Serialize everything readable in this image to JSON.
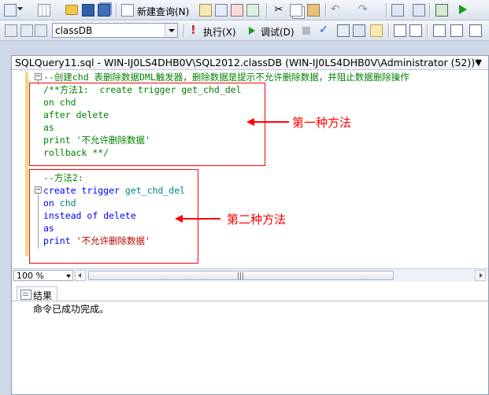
{
  "toolbar1": {
    "new_query_label": "新建查询(N)"
  },
  "toolbar2": {
    "database_value": "classDB",
    "execute_label": "执行(X)",
    "debug_label": "调试(D)"
  },
  "document": {
    "title": "SQLQuery11.sql - WIN-IJ0LS4DHB0V\\SQL2012.classDB (WIN-IJ0LS4DHB0V\\Administrator (52))*"
  },
  "editor": {
    "line1": "--创建chd 表删除数据DML触发器，删除数据是提示不允许删除数据，并阻止数据删除操作",
    "m1_comment_open": "/**方法1:  ",
    "m1_create": "create",
    "m1_trigger": "trigger",
    "m1_name": "get_chd_del",
    "m1_on": "on",
    "m1_table": "chd",
    "m1_after": "after",
    "m1_delete": "delete",
    "m1_as": "as",
    "m1_print": "print",
    "m1_msg": "'不允许删除数据'",
    "m1_rollback": "rollback",
    "m1_comment_close": "**/",
    "m2_comment": "--方法2:",
    "m2_create": "create",
    "m2_trigger": "trigger",
    "m2_name": "get_chd_del",
    "m2_on": "on",
    "m2_table": "chd",
    "m2_instead": "instead",
    "m2_of": "of",
    "m2_delete": "delete",
    "m2_as": "as",
    "m2_print": "print",
    "m2_msg": "'不允许删除数据'"
  },
  "annotations": {
    "method1": "第一种方法",
    "method2": "第二种方法",
    "color": "#ff0000"
  },
  "statusbar": {
    "zoom": "100 %"
  },
  "results": {
    "tab_label": "结果",
    "message": "命令已成功完成。"
  }
}
